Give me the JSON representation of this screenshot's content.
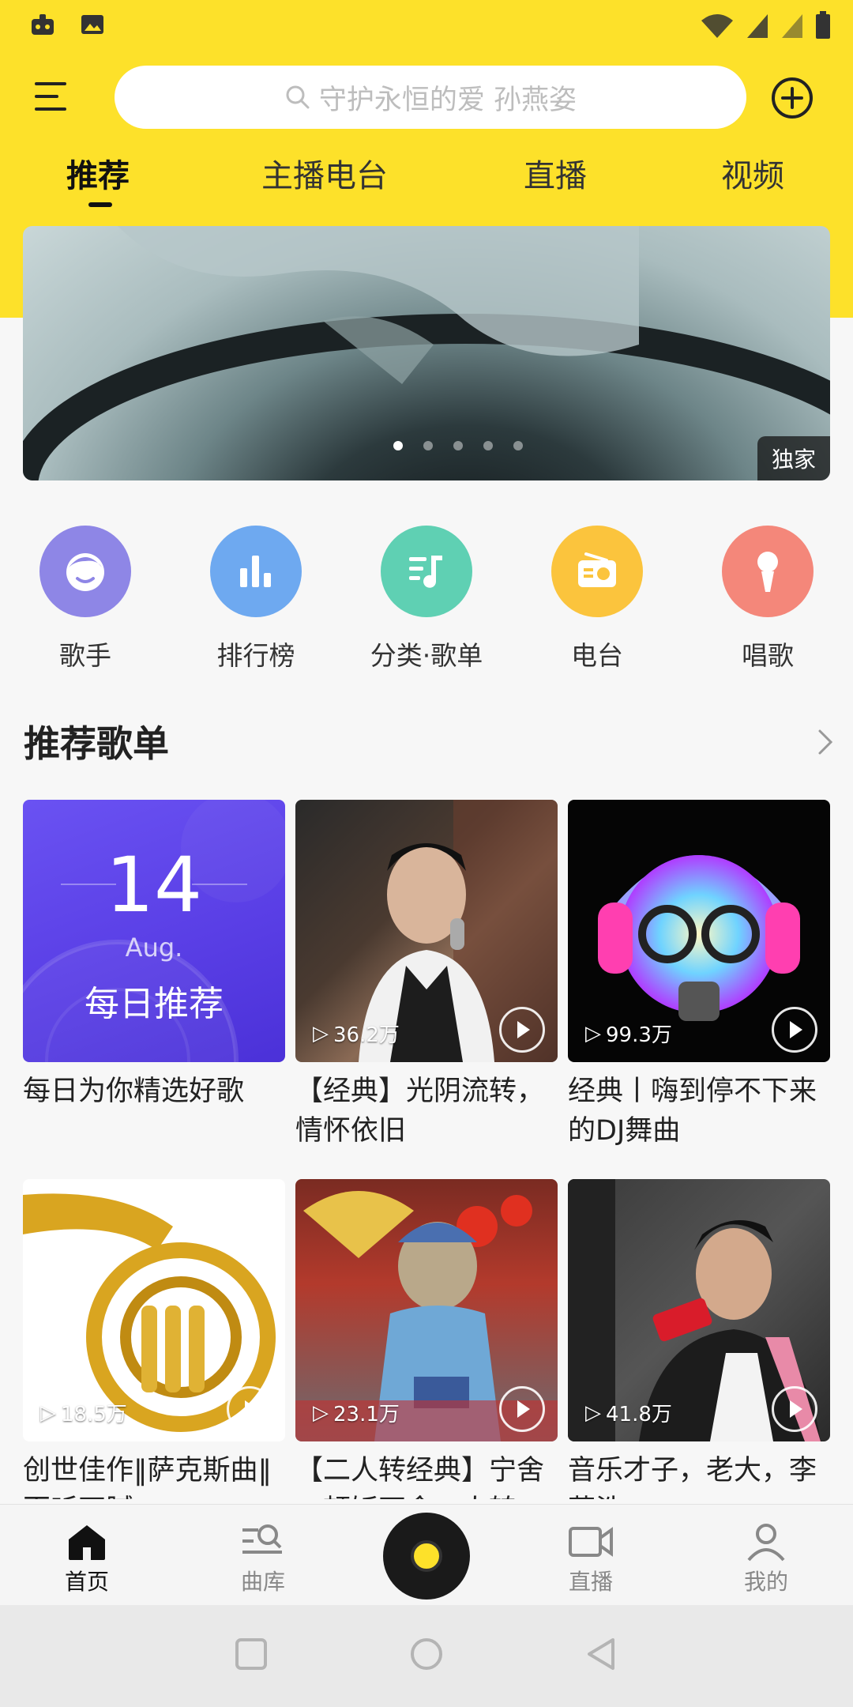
{
  "search": {
    "placeholder": "守护永恒的爱 孙燕姿"
  },
  "tabs": [
    {
      "label": "推荐"
    },
    {
      "label": "主播电台"
    },
    {
      "label": "直播"
    },
    {
      "label": "视频"
    }
  ],
  "banner": {
    "tag": "独家",
    "dots": 5,
    "active_dot": 0
  },
  "quick_items": [
    {
      "label": "歌手",
      "color": "#8e86e6",
      "icon": "singer-icon"
    },
    {
      "label": "排行榜",
      "color": "#6ea9f0",
      "icon": "chart-icon"
    },
    {
      "label": "分类·歌单",
      "color": "#5fd0b3",
      "icon": "playlist-icon"
    },
    {
      "label": "电台",
      "color": "#fbc43d",
      "icon": "radio-icon"
    },
    {
      "label": "唱歌",
      "color": "#f4877a",
      "icon": "microphone-icon"
    }
  ],
  "recommend": {
    "title": "推荐歌单",
    "daily": {
      "day": "14",
      "month": "Aug.",
      "label": "每日推荐",
      "title": "每日为你精选好歌"
    },
    "playlists": [
      {
        "count": "36.2万",
        "title": "【经典】光阴流转，情怀依旧"
      },
      {
        "count": "99.3万",
        "title": "经典丨嗨到停不下来的DJ舞曲"
      },
      {
        "count": "18.5万",
        "title": "创世佳作‖萨克斯曲‖百听不腻"
      },
      {
        "count": "23.1万",
        "title": "【二人转经典】宁舍一顿饭不舍二人转"
      },
      {
        "count": "41.8万",
        "title": "音乐才子，老大，李荣浩"
      }
    ]
  },
  "bottom_nav": {
    "home": "首页",
    "library": "曲库",
    "live": "直播",
    "me": "我的"
  },
  "colors": {
    "brand_yellow": "#fde12a",
    "daily_purple": "#5a3fe6"
  }
}
